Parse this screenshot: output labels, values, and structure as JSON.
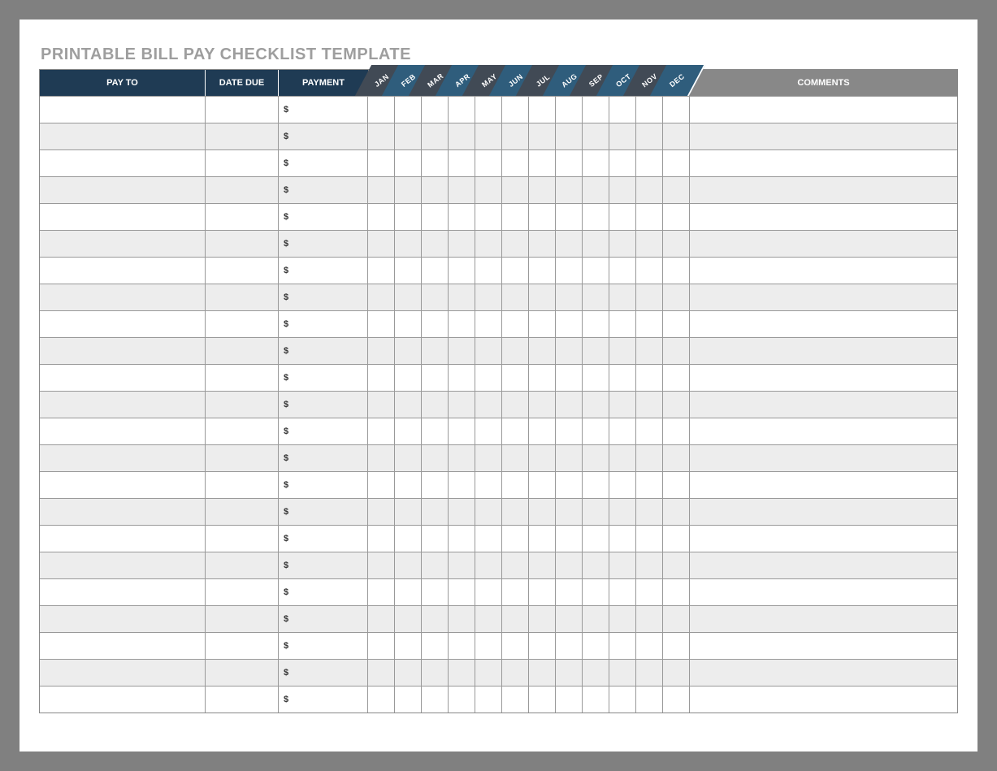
{
  "title": "PRINTABLE BILL PAY CHECKLIST TEMPLATE",
  "headers": {
    "pay_to": "PAY TO",
    "date_due": "DATE DUE",
    "payment": "PAYMENT",
    "comments": "COMMENTS"
  },
  "months": [
    "JAN",
    "FEB",
    "MAR",
    "APR",
    "MAY",
    "JUN",
    "JUL",
    "AUG",
    "SEP",
    "OCT",
    "NOV",
    "DEC"
  ],
  "currency_symbol": "$",
  "rows": [
    {
      "pay_to": "",
      "date_due": "",
      "payment": "",
      "comments": ""
    },
    {
      "pay_to": "",
      "date_due": "",
      "payment": "",
      "comments": ""
    },
    {
      "pay_to": "",
      "date_due": "",
      "payment": "",
      "comments": ""
    },
    {
      "pay_to": "",
      "date_due": "",
      "payment": "",
      "comments": ""
    },
    {
      "pay_to": "",
      "date_due": "",
      "payment": "",
      "comments": ""
    },
    {
      "pay_to": "",
      "date_due": "",
      "payment": "",
      "comments": ""
    },
    {
      "pay_to": "",
      "date_due": "",
      "payment": "",
      "comments": ""
    },
    {
      "pay_to": "",
      "date_due": "",
      "payment": "",
      "comments": ""
    },
    {
      "pay_to": "",
      "date_due": "",
      "payment": "",
      "comments": ""
    },
    {
      "pay_to": "",
      "date_due": "",
      "payment": "",
      "comments": ""
    },
    {
      "pay_to": "",
      "date_due": "",
      "payment": "",
      "comments": ""
    },
    {
      "pay_to": "",
      "date_due": "",
      "payment": "",
      "comments": ""
    },
    {
      "pay_to": "",
      "date_due": "",
      "payment": "",
      "comments": ""
    },
    {
      "pay_to": "",
      "date_due": "",
      "payment": "",
      "comments": ""
    },
    {
      "pay_to": "",
      "date_due": "",
      "payment": "",
      "comments": ""
    },
    {
      "pay_to": "",
      "date_due": "",
      "payment": "",
      "comments": ""
    },
    {
      "pay_to": "",
      "date_due": "",
      "payment": "",
      "comments": ""
    },
    {
      "pay_to": "",
      "date_due": "",
      "payment": "",
      "comments": ""
    },
    {
      "pay_to": "",
      "date_due": "",
      "payment": "",
      "comments": ""
    },
    {
      "pay_to": "",
      "date_due": "",
      "payment": "",
      "comments": ""
    },
    {
      "pay_to": "",
      "date_due": "",
      "payment": "",
      "comments": ""
    },
    {
      "pay_to": "",
      "date_due": "",
      "payment": "",
      "comments": ""
    },
    {
      "pay_to": "",
      "date_due": "",
      "payment": "",
      "comments": ""
    }
  ],
  "colors": {
    "header_dark_blue": "#1f3b54",
    "tab_dark": "#414a55",
    "tab_blue": "#2f5d7c",
    "grey": "#888888",
    "row_alt": "#ededed"
  }
}
